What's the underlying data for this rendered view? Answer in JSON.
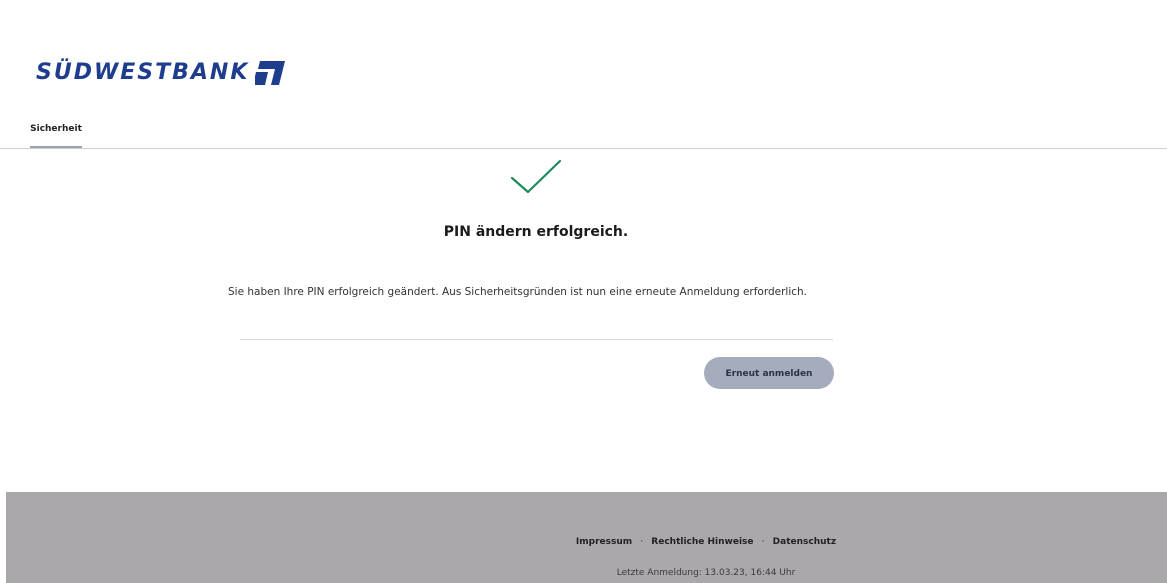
{
  "brand": {
    "name": "SÜDWESTBANK",
    "color": "#1f3d8e"
  },
  "tabs": [
    {
      "label": "Sicherheit",
      "active": true
    }
  ],
  "status": {
    "icon": "checkmark-icon",
    "color": "#1e8a5a",
    "title": "PIN ändern erfolgreich.",
    "message": "Sie haben Ihre PIN erfolgreich geändert. Aus Sicherheitsgründen ist nun eine erneute Anmeldung erforderlich."
  },
  "actions": {
    "relogin_label": "Erneut anmelden"
  },
  "footer": {
    "links": [
      {
        "label": "Impressum"
      },
      {
        "label": "Rechtliche Hinweise"
      },
      {
        "label": "Datenschutz"
      }
    ],
    "separator": "·",
    "last_login": "Letzte Anmeldung: 13.03.23, 16:44 Uhr"
  }
}
